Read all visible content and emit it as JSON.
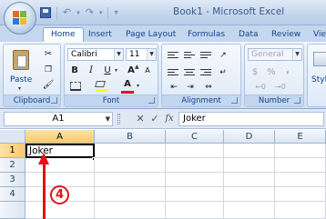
{
  "window": {
    "title": "Book1 - Microsoft Excel"
  },
  "quick_access": {
    "icons": [
      "save-icon",
      "undo-icon",
      "redo-icon",
      "customize-icon"
    ]
  },
  "tabs": [
    {
      "label": "Home",
      "active": true
    },
    {
      "label": "Insert"
    },
    {
      "label": "Page Layout"
    },
    {
      "label": "Formulas"
    },
    {
      "label": "Data"
    },
    {
      "label": "Review"
    },
    {
      "label": "Vie"
    }
  ],
  "ribbon": {
    "clipboard": {
      "label": "Clipboard",
      "paste_label": "Paste"
    },
    "font": {
      "label": "Font",
      "font_name": "Calibri",
      "font_size": "11",
      "bold": "B",
      "italic": "I",
      "underline": "U",
      "grow": "A",
      "shrink": "A",
      "font_color_glyph": "A"
    },
    "alignment": {
      "label": "Alignment"
    },
    "number": {
      "label": "Number",
      "format": "General",
      "currency": "$",
      "percent": "%",
      "comma": ","
    },
    "styles": {
      "label": "Styl"
    }
  },
  "formula_bar": {
    "name_box": "A1",
    "fx_label": "fx",
    "content": "Joker"
  },
  "sheet": {
    "columns": [
      "A",
      "B",
      "C",
      "D",
      "E"
    ],
    "rows": [
      "1",
      "2",
      "3",
      "4"
    ],
    "cells": {
      "A1": "Joker"
    },
    "active_cell": "A1"
  },
  "annotation": {
    "step_number": "4",
    "color": "#e0121a"
  },
  "colors": {
    "ribbon_blue": "#dce8f6",
    "text_blue": "#15428b",
    "selected_header": "#f8c96b"
  }
}
